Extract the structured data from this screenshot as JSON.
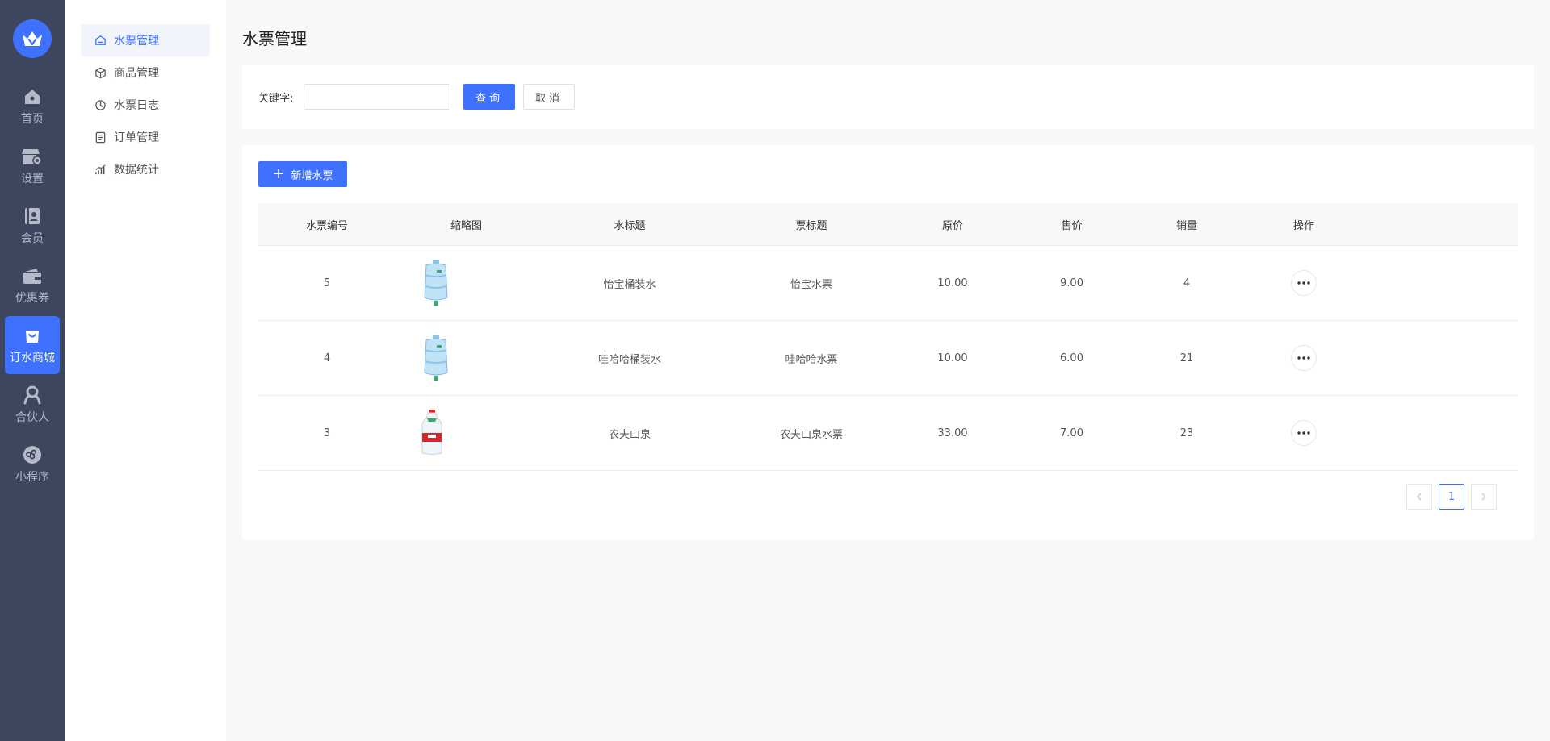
{
  "nav": [
    {
      "label": "首页",
      "icon": "home-icon"
    },
    {
      "label": "设置",
      "icon": "store-settings-icon"
    },
    {
      "label": "会员",
      "icon": "member-card-icon"
    },
    {
      "label": "优惠券",
      "icon": "wallet-coupon-icon"
    },
    {
      "label": "订水商城",
      "icon": "shopping-bag-icon"
    },
    {
      "label": "合伙人",
      "icon": "partner-icon"
    },
    {
      "label": "小程序",
      "icon": "mini-program-icon"
    }
  ],
  "nav_active": "订水商城",
  "submenu": [
    {
      "label": "水票管理",
      "icon": "ticket-icon"
    },
    {
      "label": "商品管理",
      "icon": "box-icon"
    },
    {
      "label": "水票日志",
      "icon": "clock-log-icon"
    },
    {
      "label": "订单管理",
      "icon": "order-doc-icon"
    },
    {
      "label": "数据统计",
      "icon": "stats-chart-icon"
    }
  ],
  "submenu_active": "水票管理",
  "page_title": "水票管理",
  "search": {
    "label": "关键字:",
    "value": "",
    "placeholder": "",
    "query_button": "查询",
    "cancel_button": "取消"
  },
  "add_button": "新增水票",
  "table": {
    "columns": [
      "水票编号",
      "缩略图",
      "水标题",
      "票标题",
      "原价",
      "售价",
      "销量",
      "操作"
    ],
    "rows": [
      {
        "id": "5",
        "thumb": "bucket-water-image",
        "water_title": "怡宝桶装水",
        "ticket_title": "怡宝水票",
        "original_price": "10.00",
        "sale_price": "9.00",
        "sales": "4"
      },
      {
        "id": "4",
        "thumb": "bucket-water-image",
        "water_title": "哇哈哈桶装水",
        "ticket_title": "哇哈哈水票",
        "original_price": "10.00",
        "sale_price": "6.00",
        "sales": "21"
      },
      {
        "id": "3",
        "thumb": "bottle-water-image",
        "water_title": "农夫山泉",
        "ticket_title": "农夫山泉水票",
        "original_price": "33.00",
        "sale_price": "7.00",
        "sales": "23"
      }
    ]
  },
  "pagination": {
    "current": "1",
    "prev_icon": "chevron-left-icon",
    "next_icon": "chevron-right-icon"
  },
  "colors": {
    "primary": "#3f71ff",
    "rail_bg": "#3c465c",
    "page_bg": "#f7f8fa"
  }
}
